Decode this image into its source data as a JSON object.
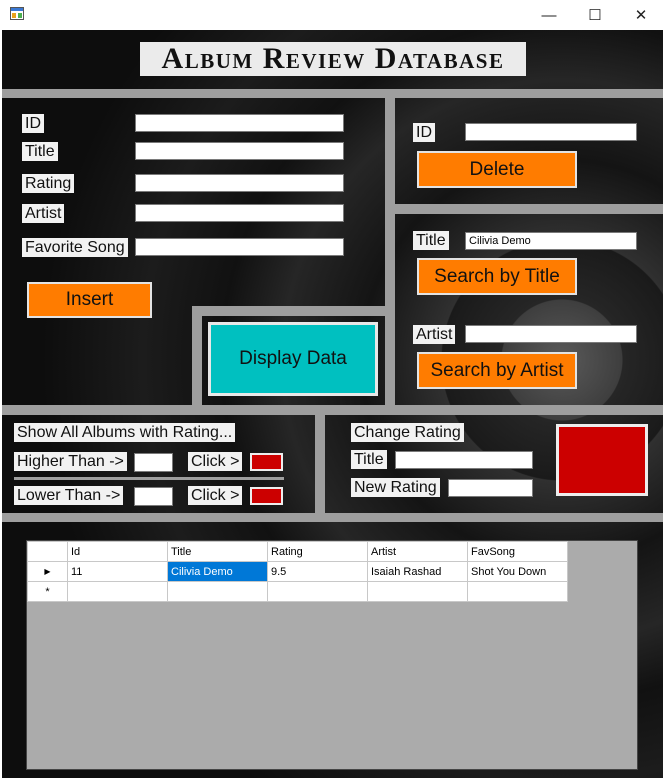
{
  "window": {
    "minimize_glyph": "—",
    "maximize_glyph": "☐",
    "close_glyph": "✕"
  },
  "header": {
    "title": "Album Review Database"
  },
  "insert_form": {
    "id_label": "ID",
    "title_label": "Title",
    "rating_label": "Rating",
    "artist_label": "Artist",
    "favsong_label": "Favorite Song",
    "id_value": "",
    "title_value": "",
    "rating_value": "",
    "artist_value": "",
    "favsong_value": "",
    "insert_button": "Insert"
  },
  "delete_form": {
    "id_label": "ID",
    "id_value": "",
    "delete_button": "Delete"
  },
  "search_form": {
    "title_label": "Title",
    "title_value": "Cilivia Demo",
    "search_title_button": "Search by Title",
    "artist_label": "Artist",
    "artist_value": "",
    "search_artist_button": "Search by Artist"
  },
  "display_button": "Display Data",
  "rating_filter": {
    "heading": "Show All Albums with Rating...",
    "higher_label": "Higher Than ->",
    "higher_value": "",
    "higher_click": "Click >",
    "lower_label": "Lower Than ->",
    "lower_value": "",
    "lower_click": "Click >",
    "swatch_color": "#cc0000"
  },
  "change_rating": {
    "heading": "Change Rating",
    "title_label": "Title",
    "title_value": "",
    "new_rating_label": "New Rating",
    "new_rating_value": ""
  },
  "grid": {
    "columns": [
      "Id",
      "Title",
      "Rating",
      "Artist",
      "FavSong"
    ],
    "rows": [
      {
        "marker": "▶",
        "cells": [
          "11",
          "Cilivia Demo",
          "9.5",
          "Isaiah Rashad",
          "Shot You Down"
        ]
      }
    ],
    "new_row_marker": "*"
  },
  "colors": {
    "orange": "#ff7c00",
    "cyan": "#00c0c0",
    "red": "#cc0000",
    "selection": "#0078d7"
  }
}
